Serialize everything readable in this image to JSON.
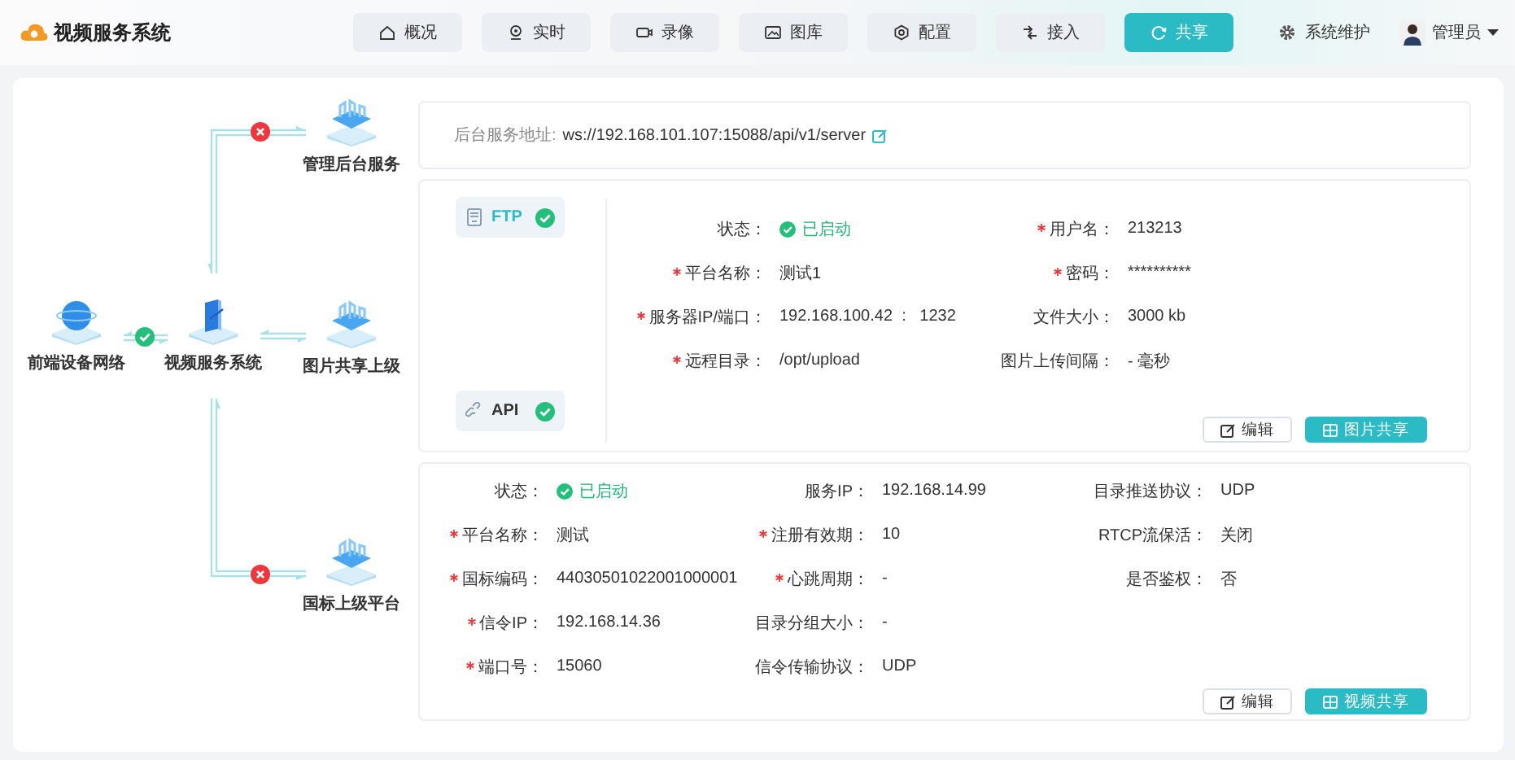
{
  "app": {
    "title": "视频服务系统"
  },
  "nav": [
    {
      "label": "概况",
      "selected": false
    },
    {
      "label": "实时",
      "selected": false
    },
    {
      "label": "录像",
      "selected": false
    },
    {
      "label": "图库",
      "selected": false
    },
    {
      "label": "配置",
      "selected": false
    },
    {
      "label": "接入",
      "selected": false
    },
    {
      "label": "共享",
      "selected": true
    }
  ],
  "header_actions": {
    "maintenance": "系统维护",
    "user": "管理员"
  },
  "topology": {
    "nodes": [
      {
        "label": "前端设备网络",
        "kind": "globe",
        "connected": true
      },
      {
        "label": "视频服务系统",
        "kind": "hub"
      },
      {
        "label": "管理后台服务",
        "kind": "platform",
        "connected": false
      },
      {
        "label": "图片共享上级",
        "kind": "platform"
      },
      {
        "label": "国标上级平台",
        "kind": "platform",
        "connected": false
      }
    ]
  },
  "server_address": {
    "label": "后台服务地址:",
    "value": "ws://192.168.101.107:15088/api/v1/server"
  },
  "image_share": {
    "protocols": [
      {
        "label": "FTP",
        "selected": true,
        "enabled": true
      },
      {
        "label": "API",
        "selected": false,
        "enabled": true
      }
    ],
    "columns": [
      [
        {
          "label": "状态：",
          "value": "已启动",
          "required": false,
          "kind": "status"
        },
        {
          "label": "平台名称：",
          "value": "测试1",
          "required": true,
          "kind": "text"
        },
        {
          "label": "服务器IP/端口：",
          "value": "192.168.100.42  :   1232",
          "required": true,
          "kind": "text"
        },
        {
          "label": "远程目录：",
          "value": "/opt/upload",
          "required": true,
          "kind": "text"
        }
      ],
      [
        {
          "label": "用户名：",
          "value": "213213",
          "required": true,
          "kind": "text"
        },
        {
          "label": "密码：",
          "value": "**********",
          "required": true,
          "kind": "text"
        },
        {
          "label": "文件大小：",
          "value": "3000 kb",
          "required": false,
          "kind": "text"
        },
        {
          "label": "图片上传间隔：",
          "value": "- 毫秒",
          "required": false,
          "kind": "text"
        }
      ]
    ],
    "buttons": [
      {
        "label": "编辑",
        "kind": "secondary"
      },
      {
        "label": "图片共享",
        "kind": "primary"
      }
    ]
  },
  "video_share": {
    "columns": [
      [
        {
          "label": "状态：",
          "value": "已启动",
          "required": false,
          "kind": "status"
        },
        {
          "label": "平台名称：",
          "value": "测试",
          "required": true,
          "kind": "text"
        },
        {
          "label": "国标编码：",
          "value": "44030501022001000001",
          "required": true,
          "kind": "text"
        },
        {
          "label": "信令IP：",
          "value": "192.168.14.36",
          "required": true,
          "kind": "text"
        },
        {
          "label": "端口号：",
          "value": "15060",
          "required": true,
          "kind": "text"
        }
      ],
      [
        {
          "label": "服务IP：",
          "value": "192.168.14.99",
          "required": false,
          "kind": "text"
        },
        {
          "label": "注册有效期：",
          "value": "10",
          "required": true,
          "kind": "text"
        },
        {
          "label": "心跳周期：",
          "value": "-",
          "required": true,
          "kind": "text"
        },
        {
          "label": "目录分组大小：",
          "value": "-",
          "required": false,
          "kind": "text"
        },
        {
          "label": "信令传输协议：",
          "value": "UDP",
          "required": false,
          "kind": "text"
        }
      ],
      [
        {
          "label": "目录推送协议：",
          "value": "UDP",
          "required": false,
          "kind": "text"
        },
        {
          "label": "RTCP流保活：",
          "value": "关闭",
          "required": false,
          "kind": "text"
        },
        {
          "label": "是否鉴权：",
          "value": "否",
          "required": false,
          "kind": "text"
        }
      ]
    ],
    "buttons": [
      {
        "label": "编辑",
        "kind": "secondary"
      },
      {
        "label": "视频共享",
        "kind": "primary"
      }
    ]
  }
}
